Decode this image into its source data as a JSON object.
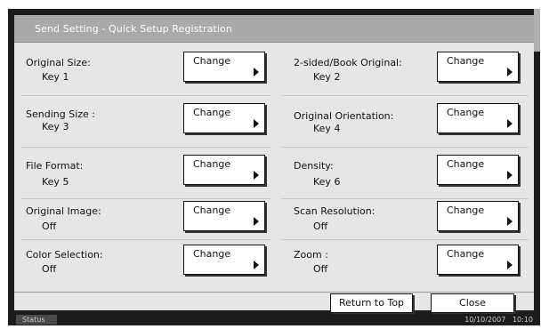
{
  "window": {
    "title": "Send Setting - Quick Setup Registration"
  },
  "settings": [
    {
      "label": "Original Size:",
      "value": "Key 1",
      "button": "Change"
    },
    {
      "label": "2-sided/Book Original:",
      "value": "Key 2",
      "button": "Change"
    },
    {
      "label": "Sending Size :",
      "value": "Key 3",
      "button": "Change"
    },
    {
      "label": "Original Orientation:",
      "value": "Key 4",
      "button": "Change"
    },
    {
      "label": "File Format:",
      "value": "Key 5",
      "button": "Change"
    },
    {
      "label": "Density:",
      "value": "Key 6",
      "button": "Change"
    },
    {
      "label": "Original Image:",
      "value": "Off",
      "button": "Change"
    },
    {
      "label": "Scan Resolution:",
      "value": "Off",
      "button": "Change"
    },
    {
      "label": "Color Selection:",
      "value": "Off",
      "button": "Change"
    },
    {
      "label": "Zoom :",
      "value": "Off",
      "button": "Change"
    }
  ],
  "footer": {
    "return_label": "Return to Top",
    "close_label": "Close"
  },
  "statusbar": {
    "status_label": "Status",
    "date": "10/10/2007",
    "time": "10:10"
  },
  "icons": {
    "change_arrow": "right-arrow-icon"
  }
}
